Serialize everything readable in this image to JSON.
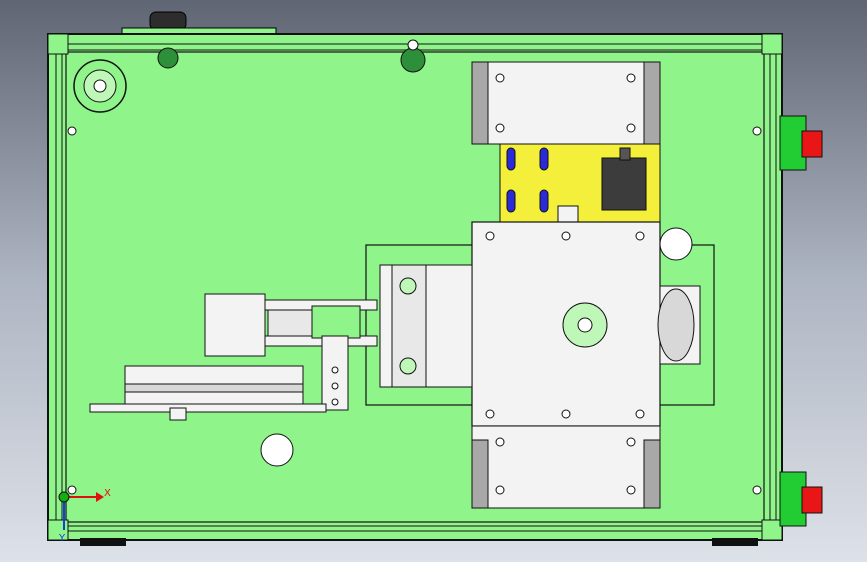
{
  "view": {
    "triad": {
      "x_label": "X",
      "y_label": "Y",
      "x_color": "#e01010",
      "y_color": "#1040e0",
      "origin_color": "#10b010"
    }
  },
  "colors": {
    "background_top": "#5f6572",
    "background_bottom": "#dde1e8",
    "base_plate": "#8ff58a",
    "frame_stroke": "#1a1a1a",
    "carriage_yellow": "#f4ef3a",
    "slot_blue": "#2a2ad6",
    "bumper_red": "#e81616",
    "bumper_green": "#22cc33",
    "part_white": "#f3f3f3",
    "rail_grey": "#a8a8a8",
    "motor_dark": "#3c3c3c"
  }
}
